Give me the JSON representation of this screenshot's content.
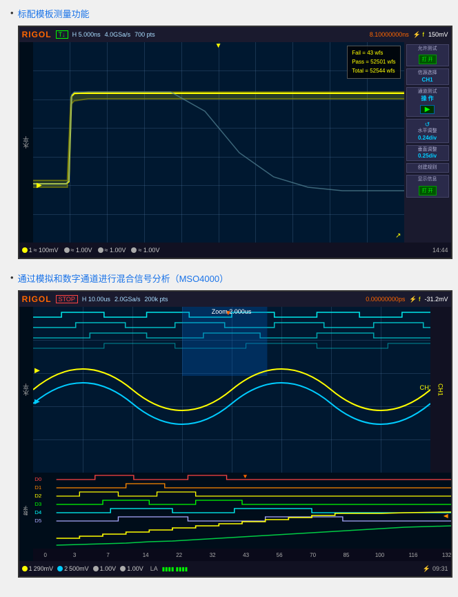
{
  "sections": [
    {
      "id": "section1",
      "link_text": "标配模板测量功能",
      "scope": {
        "brand": "RIGOL",
        "status": "T↓",
        "timebase": "H  5.000ns",
        "sample_rate": "4.0GSa/s",
        "sample_info": "700 pts",
        "trigger_level": "8.10000000ns",
        "volt_scale": "150mV",
        "trigger_icon": "f",
        "stats": {
          "fail": "Fail = 43 wfs",
          "pass": "Pass = 52501 wfs",
          "total": "Total = 52544 wfs"
        },
        "sidebar_items": [
          {
            "title": "允许测试",
            "value": "",
            "btn": "打 开",
            "btn_type": "on"
          },
          {
            "title": "信源选择",
            "value": "CH1",
            "btn": ""
          },
          {
            "title": "通道测试",
            "value": "操 作",
            "btn": "▶"
          },
          {
            "title": "水平调整",
            "value": "0.24div",
            "icon": "↺"
          },
          {
            "title": "垂直调整",
            "value": "0.25div",
            "icon": ""
          },
          {
            "title": "创建规则",
            "value": ""
          },
          {
            "title": "显示信息",
            "value": "",
            "btn": "打 开",
            "btn_type": "on"
          }
        ],
        "channels": [
          {
            "color": "#ffff00",
            "label": "1",
            "scale": "100mV"
          },
          {
            "color": "#aaaaaa",
            "label": "",
            "scale": "1.00V"
          },
          {
            "color": "#aaaaaa",
            "label": "",
            "scale": "1.00V"
          },
          {
            "color": "#aaaaaa",
            "label": "",
            "scale": "1.00V"
          }
        ],
        "time": "14:44"
      }
    },
    {
      "id": "section2",
      "link_text": "通过模拟和数字通道进行混合信号分析（MSO4000）",
      "scope": {
        "brand": "RIGOL",
        "status": "STOP",
        "timebase": "H  10.00us",
        "sample_rate": "2.0GSa/s",
        "sample_info": "200k pts",
        "trigger_level": "0.00000000ps",
        "volt_scale": "-31.2mV",
        "channels": [
          {
            "color": "#ffff00",
            "label": "1",
            "scale": "290mV"
          },
          {
            "color": "#00ccff",
            "label": "2",
            "scale": "500mV"
          },
          {
            "color": "#aaaaaa",
            "label": "",
            "scale": "1.00V"
          },
          {
            "color": "#aaaaaa",
            "label": "",
            "scale": "1.00V"
          }
        ],
        "la_label": "LA",
        "zoom_label": "Zoom 2.000us",
        "time": "09:31",
        "ch1_label": "CH1",
        "x_axis": [
          "0",
          "3",
          "7",
          "14",
          "22",
          "32",
          "43",
          "56",
          "70",
          "85",
          "100",
          "116",
          "132"
        ]
      }
    }
  ]
}
